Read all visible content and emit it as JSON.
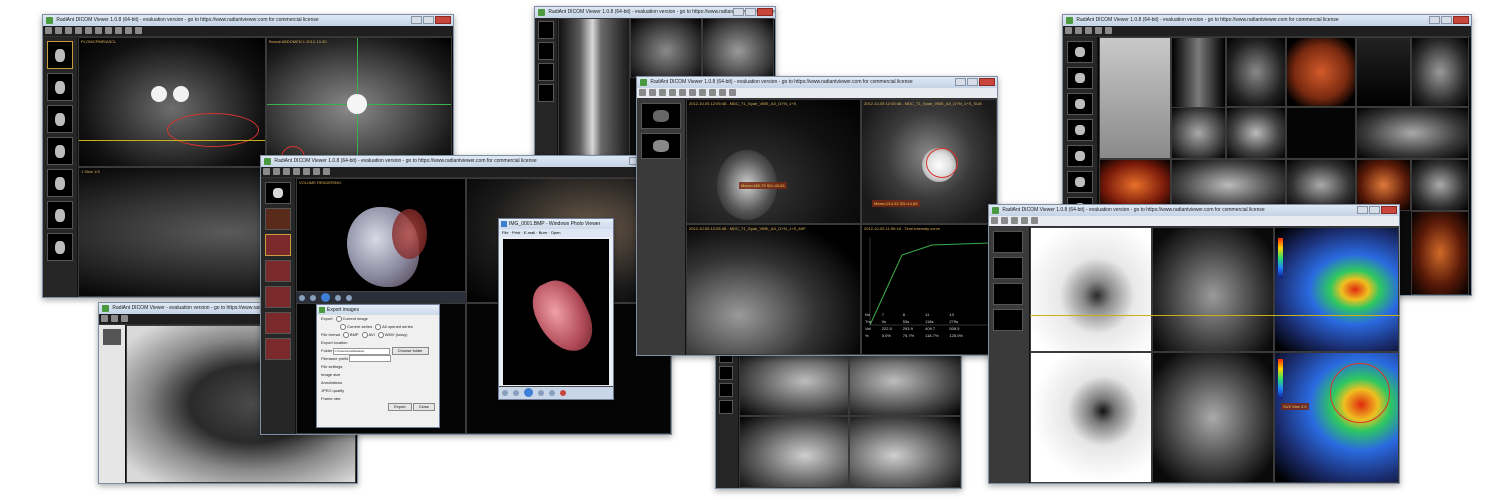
{
  "windows": {
    "top_left": {
      "title": "RadiAnt DICOM Viewer 1.0.8 (64-bit) - evaluation version - go to https://www.radiantviewer.com for commercial license",
      "label_vp1": "PLON/CPMR/ASCL",
      "label_vp2": "Boreal ABDOMEN 1  2012-10-30",
      "label_vp3": "1 Slice 1/3"
    },
    "top_center": {
      "title": "RadiAnt DICOM Viewer 1.0.8 (64-bit) - evaluation version - go to https://www.radiantviewer.com for commercial license"
    },
    "top_right": {
      "title": "RadiAnt DICOM Viewer 1.0.8 (64-bit) - evaluation version - go to https://www.radiantviewer.com for commercial license"
    },
    "xray": {
      "title": "RadiAnt DICOM Viewer - evaluation version - go to https://www.radiantviewer.com for commercial license"
    },
    "cardiac": {
      "title": "RadiAnt DICOM Viewer 1.0.8 (64-bit) - evaluation version - go to https://www.radiantviewer.com for commercial license",
      "vp_label": "VOLUME RENDERING"
    },
    "mri": {
      "title": "RadiAnt DICOM Viewer 1.0.8 (64-bit) - evaluation version - go to https://www.radiantviewer.com for commercial license",
      "vp1_label": "2012-10-05 12:05:48 - MDC_T1_Spair_VIBE_AX_DYN_1+S",
      "vp2_label": "2012-10-05 12:05:48 - MDC_T1_Spair_VIBE_AX_DYN_1+S_SUB",
      "vp3_label": "2012-10-05 12:05:48 - MDC_T1_Spair_VIBE_AX_DYN_1+S_MIP",
      "vp4_label": "2012-10-05 11:59:18 - Time-intensity curve",
      "meas1": "Mean=460,79 SD=43,66",
      "meas2": "Mean=214,33 SD=14,65",
      "table_rows": [
        [
          "No",
          "7",
          "8",
          "11",
          "13"
        ],
        [
          "Tm",
          "0s",
          "53s",
          "118s",
          "279s"
        ],
        [
          "Val",
          "222.5",
          "293.9",
          "409.7",
          "508.5"
        ],
        [
          "%",
          "0.0%",
          "75.7%",
          "118.7%",
          "125.0%"
        ]
      ]
    },
    "mammo": {
      "title": "RadiAnt DICOM Viewer"
    },
    "petct": {
      "title": "RadiAnt DICOM Viewer 1.0.8 (64-bit) - evaluation version - go to https://www.radiantviewer.com for commercial license",
      "meas": "SUV Max 3.6"
    }
  },
  "export_dialog": {
    "title": "Export images",
    "export_label": "Export",
    "opt_current_image": "Current image",
    "opt_current_series": "Current series",
    "opt_all_opened": "All opened series",
    "file_format_label": "File format",
    "fmt_bmp": "BMP",
    "fmt_avi": "AVI",
    "fmt_wmv": "WMV (lossy)",
    "location_label": "Export location",
    "folder_label": "Folder",
    "folder_value": "C:\\Users\\Luis\\Desktop",
    "choose_folder": "Choose folder",
    "filename_prefix": "Filename prefix",
    "settings_label": "File settings",
    "image_size": "Image size",
    "annotations": "Annotations",
    "jpeg_quality": "JPEG quality",
    "frame_rate": "Frame rate",
    "export_btn": "Export",
    "close_btn": "Close"
  },
  "photo_viewer": {
    "title": "IMG_0001.BMP - Windows Photo Viewer",
    "menu": [
      "File",
      "Print",
      "E-mail",
      "Burn",
      "Open"
    ]
  },
  "colors": {
    "accent_roi": "#d9342b",
    "measure_text": "#f2c94c",
    "title_bar": "#c4d3e6"
  }
}
